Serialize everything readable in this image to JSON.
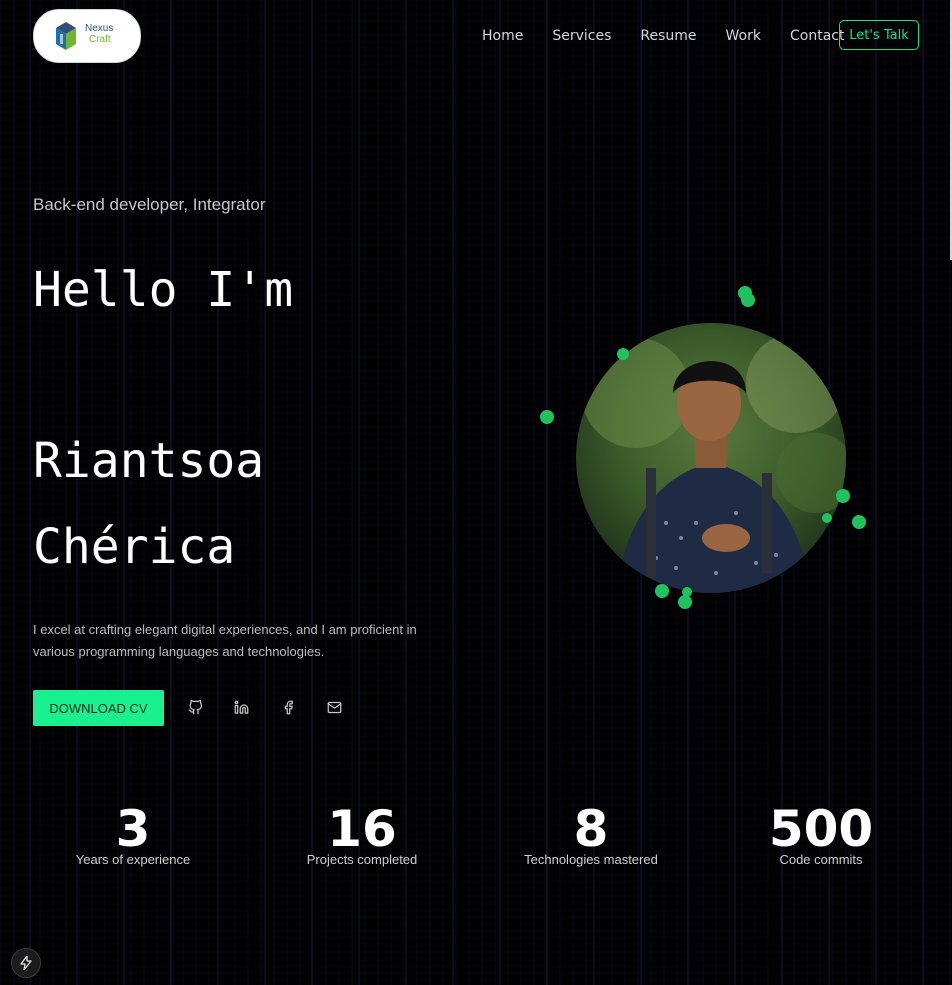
{
  "brand": {
    "line1": "Nexus",
    "line2": "Craft"
  },
  "nav": {
    "items": [
      "Home",
      "Services",
      "Resume",
      "Work",
      "Contact"
    ],
    "cta": "Let's Talk"
  },
  "hero": {
    "role": "Back-end developer, Integrator",
    "greeting": "Hello I'm",
    "first_name": "Riantsoa",
    "last_name": "Chérica",
    "intro": "I excel at crafting elegant digital experiences, and I am proficient in various programming languages and technologies.",
    "download_label": "DOWNLOAD CV",
    "socials": [
      "github-icon",
      "linkedin-icon",
      "facebook-icon",
      "mail-icon"
    ]
  },
  "stats": [
    {
      "value": "3",
      "label": "Years of experience"
    },
    {
      "value": "16",
      "label": "Projects completed"
    },
    {
      "value": "8",
      "label": "Technologies mastered"
    },
    {
      "value": "500",
      "label": "Code commits"
    }
  ],
  "colors": {
    "accent": "#19f08f",
    "background": "#030306",
    "dots": "#1fc25f"
  }
}
